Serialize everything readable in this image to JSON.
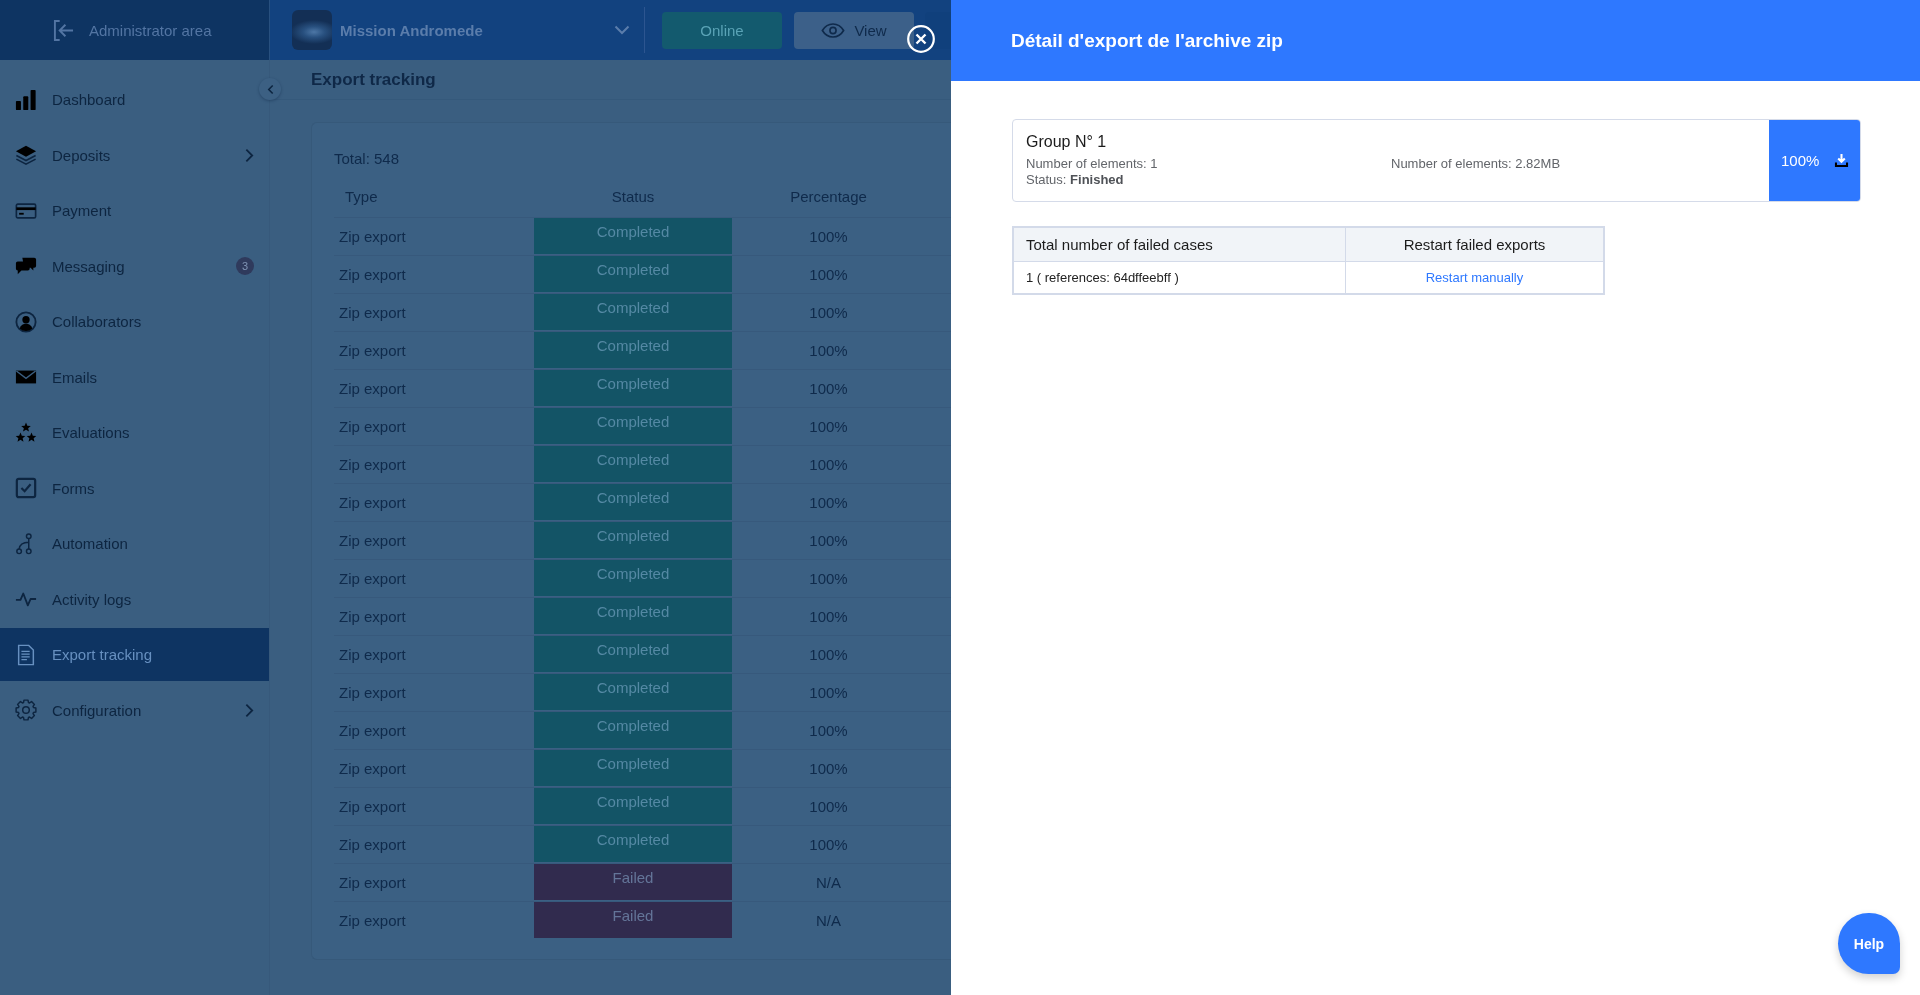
{
  "header": {
    "admin_area": "Administrator area",
    "project": "Mission Andromede",
    "buttons": [
      {
        "kind": "status",
        "label": "Online"
      },
      {
        "kind": "view",
        "label": "View"
      },
      {
        "kind": "cut_off"
      }
    ]
  },
  "sidebar": {
    "items": [
      {
        "label": "Dashboard",
        "selected": false,
        "has_submenu": false
      },
      {
        "label": "Deposits",
        "selected": false,
        "has_submenu": true
      },
      {
        "label": "Payment",
        "selected": false,
        "has_submenu": false
      },
      {
        "label": "Messaging",
        "selected": false,
        "has_submenu": false,
        "badge": "3"
      },
      {
        "label": "Collaborators",
        "selected": false,
        "has_submenu": false
      },
      {
        "label": "Emails",
        "selected": false,
        "has_submenu": false
      },
      {
        "label": "Evaluations",
        "selected": false,
        "has_submenu": false
      },
      {
        "label": "Forms",
        "selected": false,
        "has_submenu": false
      },
      {
        "label": "Automation",
        "selected": false,
        "has_submenu": false
      },
      {
        "label": "Activity logs",
        "selected": false,
        "has_submenu": false
      },
      {
        "label": "Export tracking",
        "selected": true,
        "has_submenu": false
      },
      {
        "label": "Configuration",
        "selected": false,
        "has_submenu": true
      }
    ]
  },
  "page": {
    "title": "Export tracking",
    "total": "Total: 548",
    "table": {
      "columns": [
        "Type",
        "Status",
        "Percentage"
      ],
      "rows": [
        {
          "type": "Zip export",
          "status": {
            "label": "Completed",
            "color": "#135466"
          },
          "percentage": "100%"
        },
        {
          "type": "Zip export",
          "status": {
            "label": "Completed",
            "color": "#135466"
          },
          "percentage": "100%"
        },
        {
          "type": "Zip export",
          "status": {
            "label": "Completed",
            "color": "#135466"
          },
          "percentage": "100%"
        },
        {
          "type": "Zip export",
          "status": {
            "label": "Completed",
            "color": "#135466"
          },
          "percentage": "100%"
        },
        {
          "type": "Zip export",
          "status": {
            "label": "Completed",
            "color": "#135466"
          },
          "percentage": "100%"
        },
        {
          "type": "Zip export",
          "status": {
            "label": "Completed",
            "color": "#135466"
          },
          "percentage": "100%"
        },
        {
          "type": "Zip export",
          "status": {
            "label": "Completed",
            "color": "#135466"
          },
          "percentage": "100%"
        },
        {
          "type": "Zip export",
          "status": {
            "label": "Completed",
            "color": "#135466"
          },
          "percentage": "100%"
        },
        {
          "type": "Zip export",
          "status": {
            "label": "Completed",
            "color": "#135466"
          },
          "percentage": "100%"
        },
        {
          "type": "Zip export",
          "status": {
            "label": "Completed",
            "color": "#135466"
          },
          "percentage": "100%"
        },
        {
          "type": "Zip export",
          "status": {
            "label": "Completed",
            "color": "#135466"
          },
          "percentage": "100%"
        },
        {
          "type": "Zip export",
          "status": {
            "label": "Completed",
            "color": "#135466"
          },
          "percentage": "100%"
        },
        {
          "type": "Zip export",
          "status": {
            "label": "Completed",
            "color": "#135466"
          },
          "percentage": "100%"
        },
        {
          "type": "Zip export",
          "status": {
            "label": "Completed",
            "color": "#135466"
          },
          "percentage": "100%"
        },
        {
          "type": "Zip export",
          "status": {
            "label": "Completed",
            "color": "#135466"
          },
          "percentage": "100%"
        },
        {
          "type": "Zip export",
          "status": {
            "label": "Completed",
            "color": "#135466"
          },
          "percentage": "100%"
        },
        {
          "type": "Zip export",
          "status": {
            "label": "Completed",
            "color": "#135466"
          },
          "percentage": "100%"
        },
        {
          "type": "Zip export",
          "status": {
            "label": "Failed",
            "color": "#312b4e"
          },
          "percentage": "N/A"
        },
        {
          "type": "Zip export",
          "status": {
            "label": "Failed",
            "color": "#312b4e"
          },
          "percentage": "N/A"
        }
      ]
    }
  },
  "drawer": {
    "title": "Détail d'export de l'archive zip",
    "group": {
      "title": "Group N° 1",
      "elements": "Number of elements: 1",
      "status": "Status: **Finished**",
      "size": "Number of elements: 2.82MB",
      "percentage": "100%"
    },
    "failed_table": {
      "columns": [
        "Total number of failed cases",
        "Restart failed exports"
      ],
      "rows": [
        {
          "cases": "1 ( references: 64dffeebff )",
          "action": "Restart manually"
        }
      ]
    }
  },
  "help": {
    "label": "Help"
  }
}
